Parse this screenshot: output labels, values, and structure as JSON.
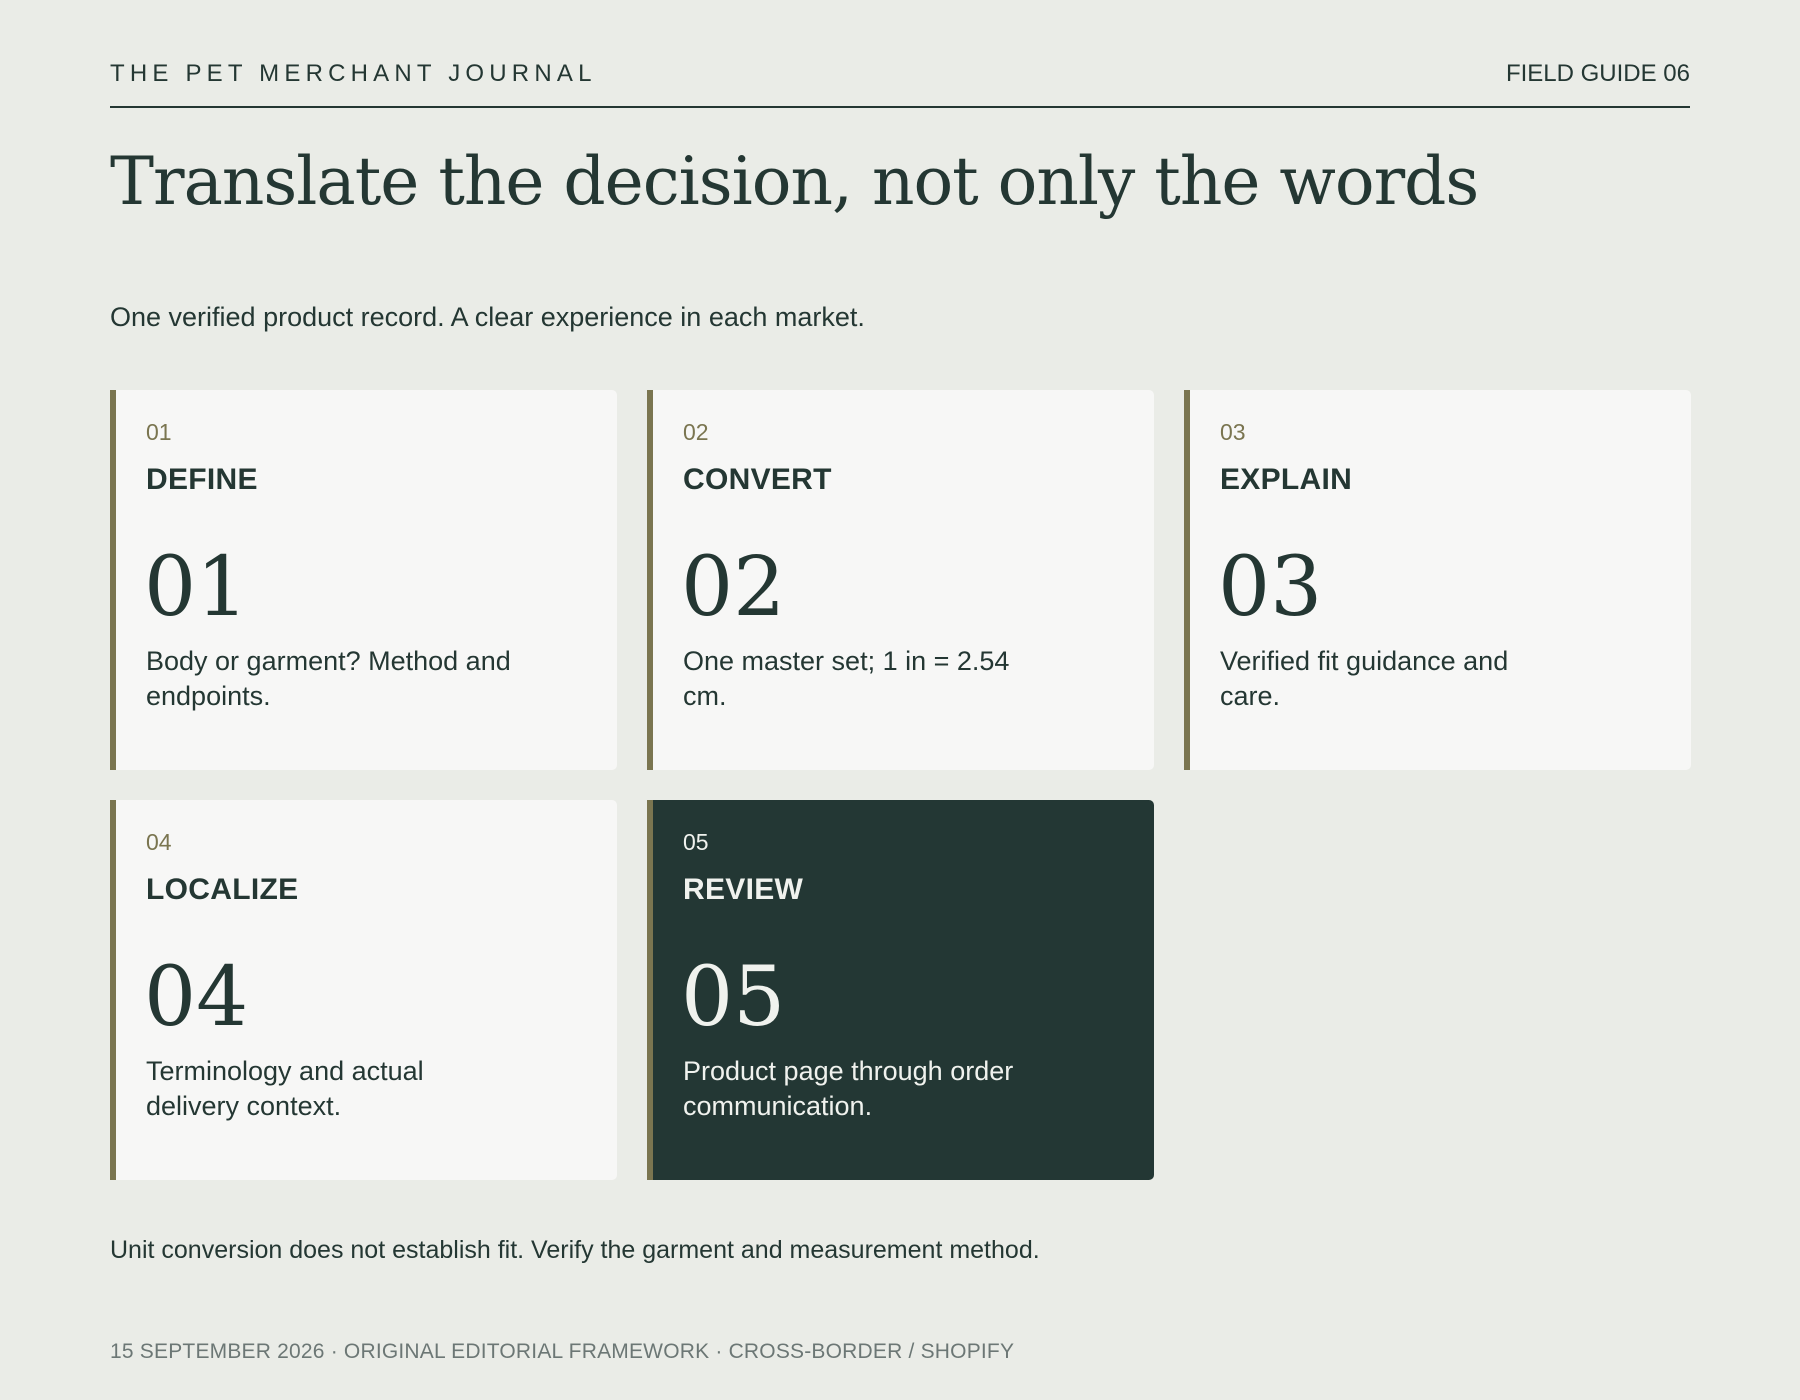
{
  "masthead": {
    "publication": "THE PET MERCHANT JOURNAL",
    "guide": "FIELD GUIDE 06"
  },
  "headline": "Translate the decision, not only the words",
  "subhead": "One verified product record. A clear experience in each market.",
  "steps": [
    {
      "number": "01",
      "title": "DEFINE",
      "big": "01",
      "description": "Body or garment? Method and endpoints.",
      "highlighted": false
    },
    {
      "number": "02",
      "title": "CONVERT",
      "big": "02",
      "description": "One master set; 1 in = 2.54 cm.",
      "highlighted": false
    },
    {
      "number": "03",
      "title": "EXPLAIN",
      "big": "03",
      "description": "Verified fit guidance and care.",
      "highlighted": false
    },
    {
      "number": "04",
      "title": "LOCALIZE",
      "big": "04",
      "description": "Terminology and actual delivery context.",
      "highlighted": false
    },
    {
      "number": "05",
      "title": "REVIEW",
      "big": "05",
      "description": "Product page through order communication.",
      "highlighted": true
    }
  ],
  "note": "Unit conversion does not establish fit. Verify the garment and measurement method.",
  "footer": "15 SEPTEMBER 2026 · ORIGINAL EDITORIAL FRAMEWORK · CROSS-BORDER / SHOPIFY",
  "colors": {
    "background": "#eaece7",
    "ink": "#243733",
    "accent": "#7a7550",
    "card": "#f7f7f6",
    "highlight_card": "#233734"
  }
}
